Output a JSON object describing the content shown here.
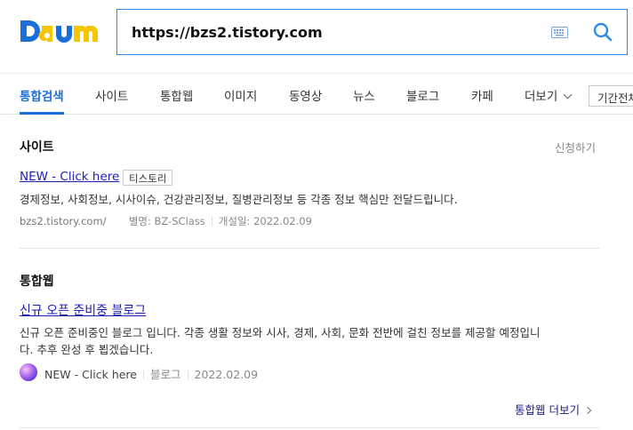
{
  "header": {
    "logo_text": "Daum",
    "search": {
      "value": "https://bzs2.tistory.com",
      "placeholder": ""
    }
  },
  "tabs": {
    "items": [
      {
        "label": "통합검색",
        "active": true
      },
      {
        "label": "사이트"
      },
      {
        "label": "통합웹"
      },
      {
        "label": "이미지"
      },
      {
        "label": "동영상"
      },
      {
        "label": "뉴스"
      },
      {
        "label": "블로그"
      },
      {
        "label": "카페"
      },
      {
        "label": "더보기"
      }
    ],
    "period_label": "기간전체"
  },
  "site_section": {
    "title": "사이트",
    "apply_link": "신청하기",
    "result": {
      "title": "NEW - Click here",
      "badge": "티스토리",
      "description": "경제정보, 사회정보, 시사이슈, 건강관리정보, 질병관리정보 등 각종 정보 핵심만 전달드립니다.",
      "url": "bzs2.tistory.com/",
      "alias": "별명: BZ-SClass",
      "created": "개설일: 2022.02.09"
    }
  },
  "web_section": {
    "title": "통합웹",
    "result": {
      "title": "신규 오픈 준비중 블로그",
      "description_line1": "신규 오픈 준비중인 블로그 입니다. 각종 생활 정보와 시사, 경제, 사회, 문화 전반에 걸친 정보를 제공할 예정입니",
      "description_line2": "다. 추후 완성 후 뵙겠습니다.",
      "source_name": "NEW - Click here",
      "source_type": "블로그",
      "date": "2022.02.09"
    },
    "more_link": "통합웹 더보기"
  },
  "colors": {
    "accent": "#1a6fd8",
    "link": "#1d1db3",
    "search_border": "#2f8ce4",
    "logo_blue": "#1a6fd8",
    "logo_yellow": "#f7c600"
  }
}
